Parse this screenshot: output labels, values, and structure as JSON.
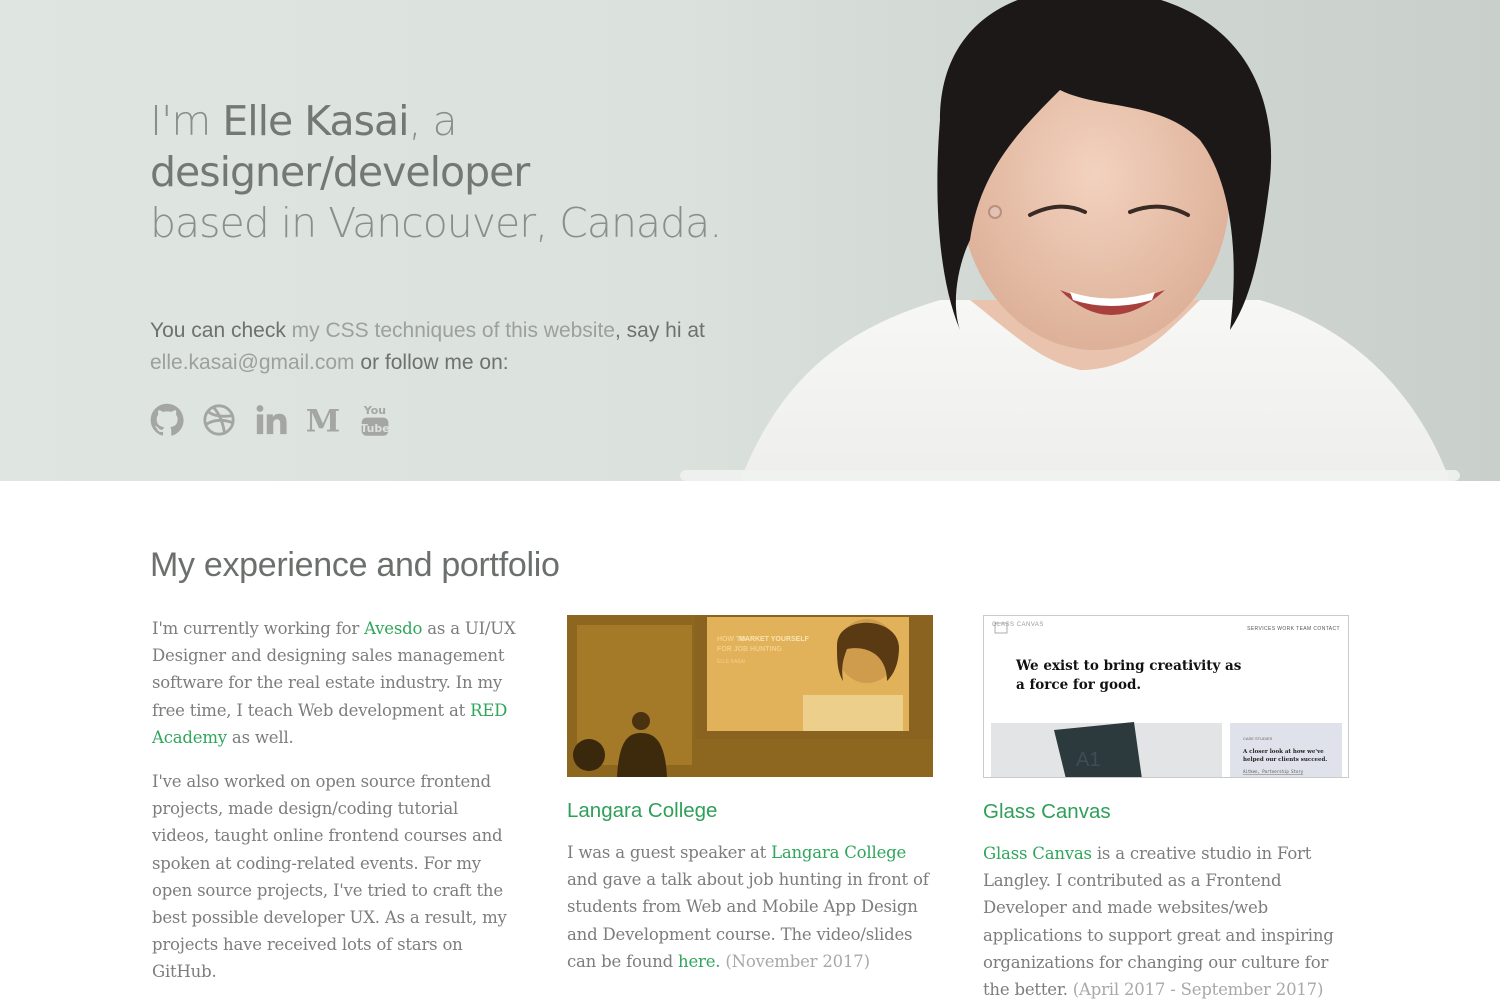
{
  "hero": {
    "headline": {
      "im": "I'm ",
      "name": "Elle Kasai",
      "a": ", a ",
      "role": "designer/developer",
      "location": "based in Vancouver, Canada."
    },
    "intro": {
      "prefix": "You can check ",
      "css_link": "my CSS techniques of this website",
      "middle": ", say hi at",
      "email": "elle.kasai@gmail.com",
      "suffix": " or follow me on:"
    },
    "socials": [
      {
        "icon": "github-icon"
      },
      {
        "icon": "dribbble-icon"
      },
      {
        "icon": "linkedin-icon"
      },
      {
        "icon": "medium-icon",
        "glyph": "M"
      },
      {
        "icon": "youtube-icon",
        "glyph_top": "You",
        "glyph_bottom": "Tube"
      }
    ]
  },
  "portfolio": {
    "title": "My experience and portfolio",
    "about": {
      "p1_a": "I'm currently working for ",
      "avesdo": "Avesdo",
      "p1_b": " as a UI/UX Designer and designing sales management software for the real estate industry. In my free time, I teach Web development at ",
      "red": "RED Academy",
      "p1_c": " as well.",
      "p2": "I've also worked on open source frontend projects, made design/coding tutorial videos, taught online frontend courses and spoken at coding-related events. For my open source projects, I've tried to craft the best possible developer UX. As a result, my projects have received lots of stars on GitHub."
    },
    "langara": {
      "title": "Langara College",
      "d1": "I was a guest speaker at ",
      "link": "Langara College",
      "d2": " and gave a talk about job hunting in front of students from Web and Mobile App Design and Development course. The video/slides can be found ",
      "here": "here.",
      "date": " (November 2017)",
      "slide_line1": "HOW TO",
      "slide_line1b": "MARKET YOURSELF",
      "slide_line2": "FOR JOB HUNTING",
      "slide_name": "ELLE KASAI"
    },
    "glass": {
      "title": "Glass Canvas",
      "link": "Glass Canvas",
      "d1": " is a creative studio in Fort Langley. I contributed as a Frontend Developer and made websites/web applications to support great and inspiring organizations for changing our culture for the better.",
      "date": " (April 2017 - September 2017)",
      "shot_logo": "GLASS CANVAS",
      "shot_nav": "SERVICES   WORK   TEAM   CONTACT",
      "shot_hero_1": "We exist to bring creativity as",
      "shot_hero_2": "a force for good.",
      "shot_case_label": "CASE STUDIES",
      "shot_case_1": "A closer look at how we've",
      "shot_case_2": "helped our clients succeed.",
      "shot_case_link": "Aitken, Partnership Story"
    }
  },
  "colors": {
    "accent": "#2fa65c",
    "hero_bg": "#dbe1dd",
    "heading": "#6c706d",
    "body_text": "#7b7e7b"
  }
}
